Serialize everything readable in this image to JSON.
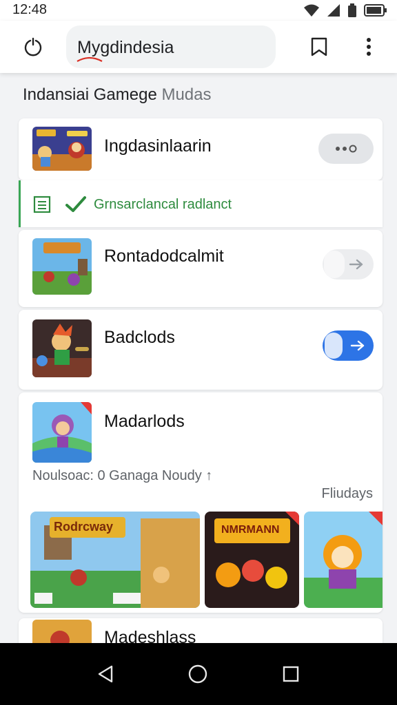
{
  "status_bar": {
    "time": "12:48",
    "icons": [
      "wifi-icon",
      "cellular-signal-icon",
      "battery-saver-icon",
      "battery-icon"
    ]
  },
  "toolbar": {
    "url_text": "Mygdindesia",
    "icons": [
      "refresh-icon",
      "bookmark-icon",
      "more-vert-icon"
    ]
  },
  "section": {
    "title_main": "Indansiai Gamege",
    "title_muted": "Mudas"
  },
  "items": [
    {
      "title": "Ingdasinlaarin",
      "control": "overflow-dots"
    },
    {
      "title": "Rontadodcalmit",
      "control": "arrow-toggle-off"
    },
    {
      "title": "Badclods",
      "control": "arrow-toggle-on"
    },
    {
      "title": "Madarlods"
    }
  ],
  "info_row": {
    "text": "Grnsarclancal radlanct",
    "icons": [
      "list-icon",
      "check-icon"
    ]
  },
  "detail": {
    "meta_left": "Noulsoac: 0 Ganaga Noudy ↑",
    "meta_right": "Fliudays"
  },
  "gallery": {
    "banner_1": "Rodrcway",
    "banner_2": "NMRMANN"
  },
  "next_item": {
    "title": "Madeshlass"
  },
  "colors": {
    "accent_blue": "#2d74e6",
    "success_green": "#2e8b3e",
    "nav_black": "#000000"
  },
  "nav_bar": {
    "icons": [
      "back-icon",
      "home-icon",
      "recents-icon"
    ]
  }
}
